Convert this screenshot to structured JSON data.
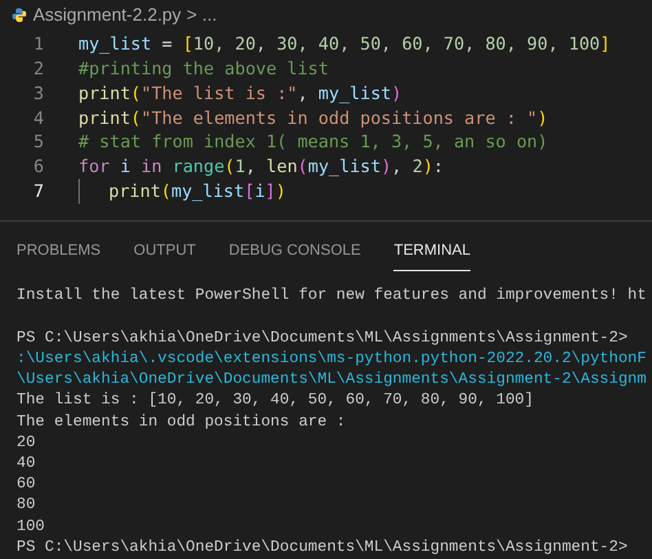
{
  "editor_tab": {
    "filename": "Assignment-2.2.py",
    "breadcrumb": "> ..."
  },
  "code_lines": [
    {
      "number": "1",
      "selected": false,
      "indent": false,
      "tokens": [
        {
          "kind": "var",
          "text": "my_list"
        },
        {
          "kind": "plain",
          "text": " = "
        },
        {
          "kind": "bracket",
          "text": "["
        },
        {
          "kind": "num",
          "text": "10, 20, 30, 40, 50, 60, 70, 80, 90, 100"
        },
        {
          "kind": "bracket",
          "text": "]"
        }
      ]
    },
    {
      "number": "2",
      "selected": false,
      "indent": false,
      "tokens": [
        {
          "kind": "comment",
          "text": "#printing the above list"
        }
      ]
    },
    {
      "number": "3",
      "selected": false,
      "indent": false,
      "tokens": [
        {
          "kind": "func",
          "text": "print"
        },
        {
          "kind": "bracket",
          "text": "("
        },
        {
          "kind": "string",
          "text": "\"The list is :\""
        },
        {
          "kind": "plain",
          "text": ", "
        },
        {
          "kind": "var",
          "text": "my_list"
        },
        {
          "kind": "bracket2",
          "text": ")"
        }
      ]
    },
    {
      "number": "4",
      "selected": false,
      "indent": false,
      "tokens": [
        {
          "kind": "func",
          "text": "print"
        },
        {
          "kind": "bracket",
          "text": "("
        },
        {
          "kind": "string",
          "text": "\"The elements in odd positions are : \""
        },
        {
          "kind": "bracket",
          "text": ")"
        }
      ]
    },
    {
      "number": "5",
      "selected": false,
      "indent": false,
      "tokens": [
        {
          "kind": "comment",
          "text": "# stat from index 1( means 1, 3, 5, an so on)"
        }
      ]
    },
    {
      "number": "6",
      "selected": false,
      "indent": false,
      "tokens": [
        {
          "kind": "keyword",
          "text": "for"
        },
        {
          "kind": "var",
          "text": " i"
        },
        {
          "kind": "keyword",
          "text": " in"
        },
        {
          "kind": "class",
          "text": " range"
        },
        {
          "kind": "bracket",
          "text": "("
        },
        {
          "kind": "num",
          "text": "1"
        },
        {
          "kind": "plain",
          "text": ", "
        },
        {
          "kind": "func",
          "text": "len"
        },
        {
          "kind": "bracket2",
          "text": "("
        },
        {
          "kind": "var",
          "text": "my_list"
        },
        {
          "kind": "bracket2",
          "text": ")"
        },
        {
          "kind": "plain",
          "text": ", "
        },
        {
          "kind": "num",
          "text": "2"
        },
        {
          "kind": "bracket",
          "text": ")"
        },
        {
          "kind": "plain",
          "text": ":"
        }
      ]
    },
    {
      "number": "7",
      "selected": true,
      "indent": true,
      "tokens": [
        {
          "kind": "func",
          "text": "print"
        },
        {
          "kind": "bracket",
          "text": "("
        },
        {
          "kind": "var",
          "text": "my_list"
        },
        {
          "kind": "bracket2",
          "text": "["
        },
        {
          "kind": "var",
          "text": "i"
        },
        {
          "kind": "bracket2",
          "text": "]"
        },
        {
          "kind": "bracket",
          "text": ")"
        }
      ]
    }
  ],
  "panel_tabs": [
    {
      "label": "PROBLEMS",
      "selected": false
    },
    {
      "label": "OUTPUT",
      "selected": false
    },
    {
      "label": "DEBUG CONSOLE",
      "selected": false
    },
    {
      "label": "TERMINAL",
      "selected": true
    }
  ],
  "terminal_lines": [
    {
      "kind": "output",
      "text": "Install the latest PowerShell for new features and improvements! ht"
    },
    {
      "kind": "blank"
    },
    {
      "kind": "prompt",
      "text": "PS C:\\Users\\akhia\\OneDrive\\Documents\\ML\\Assignments\\Assignment-2>"
    },
    {
      "kind": "command",
      "text": ":\\Users\\akhia\\.vscode\\extensions\\ms-python.python-2022.20.2\\pythonF"
    },
    {
      "kind": "command",
      "text": "\\Users\\akhia\\OneDrive\\Documents\\ML\\Assignments\\Assignment-2\\Assignm"
    },
    {
      "kind": "output",
      "text": "The list is : [10, 20, 30, 40, 50, 60, 70, 80, 90, 100]"
    },
    {
      "kind": "output",
      "text": "The elements in odd positions are :"
    },
    {
      "kind": "output",
      "text": "20"
    },
    {
      "kind": "output",
      "text": "40"
    },
    {
      "kind": "output",
      "text": "60"
    },
    {
      "kind": "output",
      "text": "80"
    },
    {
      "kind": "output",
      "text": "100"
    },
    {
      "kind": "prompt",
      "text": "PS C:\\Users\\akhia\\OneDrive\\Documents\\ML\\Assignments\\Assignment-2>"
    }
  ]
}
